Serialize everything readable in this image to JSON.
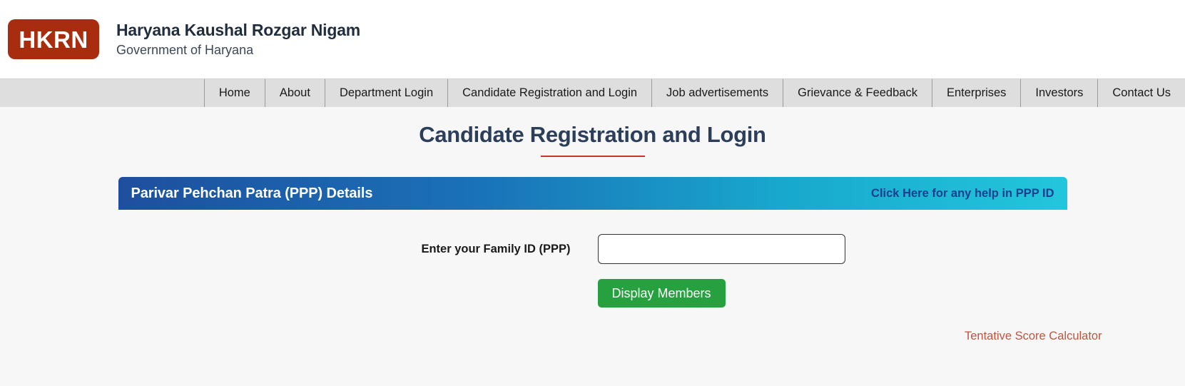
{
  "header": {
    "logo_text": "HKRN",
    "logo_color": "#a82d0e",
    "org_title": "Haryana Kaushal Rozgar Nigam",
    "org_subtitle": "Government of Haryana"
  },
  "nav": {
    "items": [
      {
        "label": "Home"
      },
      {
        "label": "About"
      },
      {
        "label": "Department Login"
      },
      {
        "label": "Candidate Registration and Login"
      },
      {
        "label": "Job advertisements"
      },
      {
        "label": "Grievance & Feedback"
      },
      {
        "label": "Enterprises"
      },
      {
        "label": "Investors"
      },
      {
        "label": "Contact Us"
      }
    ]
  },
  "page": {
    "title": "Candidate Registration and Login",
    "title_color": "#2c3e5a",
    "rule_color": "#c0392b"
  },
  "panel": {
    "title": "Parivar Pehchan Patra (PPP) Details",
    "help_link": "Click Here for any help in PPP ID",
    "gradient_start": "#1e4f9e",
    "gradient_end": "#22c6dc",
    "help_link_color": "#1a3f8f"
  },
  "form": {
    "family_id_label": "Enter your Family ID (PPP)",
    "family_id_value": "",
    "family_id_placeholder": "",
    "submit_label": "Display Members",
    "submit_color": "#27a03f"
  },
  "footer": {
    "score_link": "Tentative Score Calculator",
    "score_link_color": "#c0553f"
  }
}
